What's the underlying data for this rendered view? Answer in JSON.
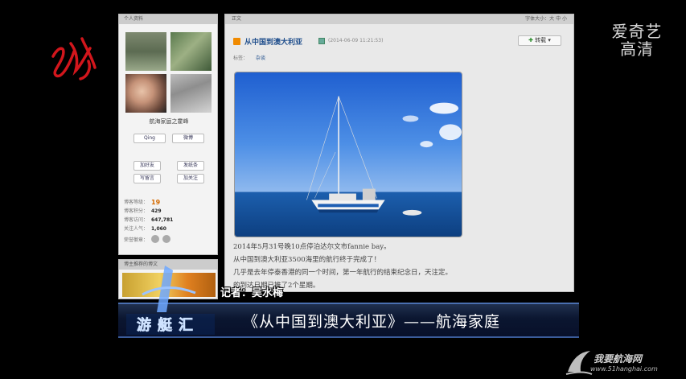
{
  "watermark": {
    "line1": "爱奇艺",
    "line2": "高清"
  },
  "sidebar": {
    "header": "个人资料",
    "nickname": "航海家庭之霍峰",
    "buttons": {
      "qing": "Qing",
      "weibo": "微博",
      "add_friend": "加好友",
      "send_msg": "发纸条",
      "write_note": "写留言",
      "follow": "加关注"
    },
    "stats": [
      {
        "label": "博客等级：",
        "value": "19"
      },
      {
        "label": "博客积分：",
        "value": "429"
      },
      {
        "label": "博客访问：",
        "value": "647,781"
      },
      {
        "label": "关注人气：",
        "value": "1,060"
      }
    ],
    "medal_label": "荣誉徽章："
  },
  "sidebar2": {
    "header": "博主推荐的博文"
  },
  "main": {
    "header_left": "正文",
    "header_right": "字体大小：大 中 小",
    "title": "从中国到澳大利亚",
    "date": "(2014-06-09 11:21:53)",
    "forward_label": "转载",
    "tags_label": "标签：",
    "tag": "杂谈",
    "paragraphs": [
      "2014年5月31号晚10点停泊达尔文市fannie bay。",
      "从中国到澳大利亚3500海里的航行终于完成了！",
      "几乎是去年停泰香港的同一个时间，第一年航行的结束纪念日，天注定。",
      "      的到达日期已推了2个星期。"
    ]
  },
  "overlay": {
    "reporter": "记者：吴水梅",
    "caption": "《从中国到澳大利亚》——航海家庭",
    "show_logo_text": "游艇汇"
  },
  "site": {
    "name": "我要航海网",
    "url": "www.51hanghai.com"
  }
}
